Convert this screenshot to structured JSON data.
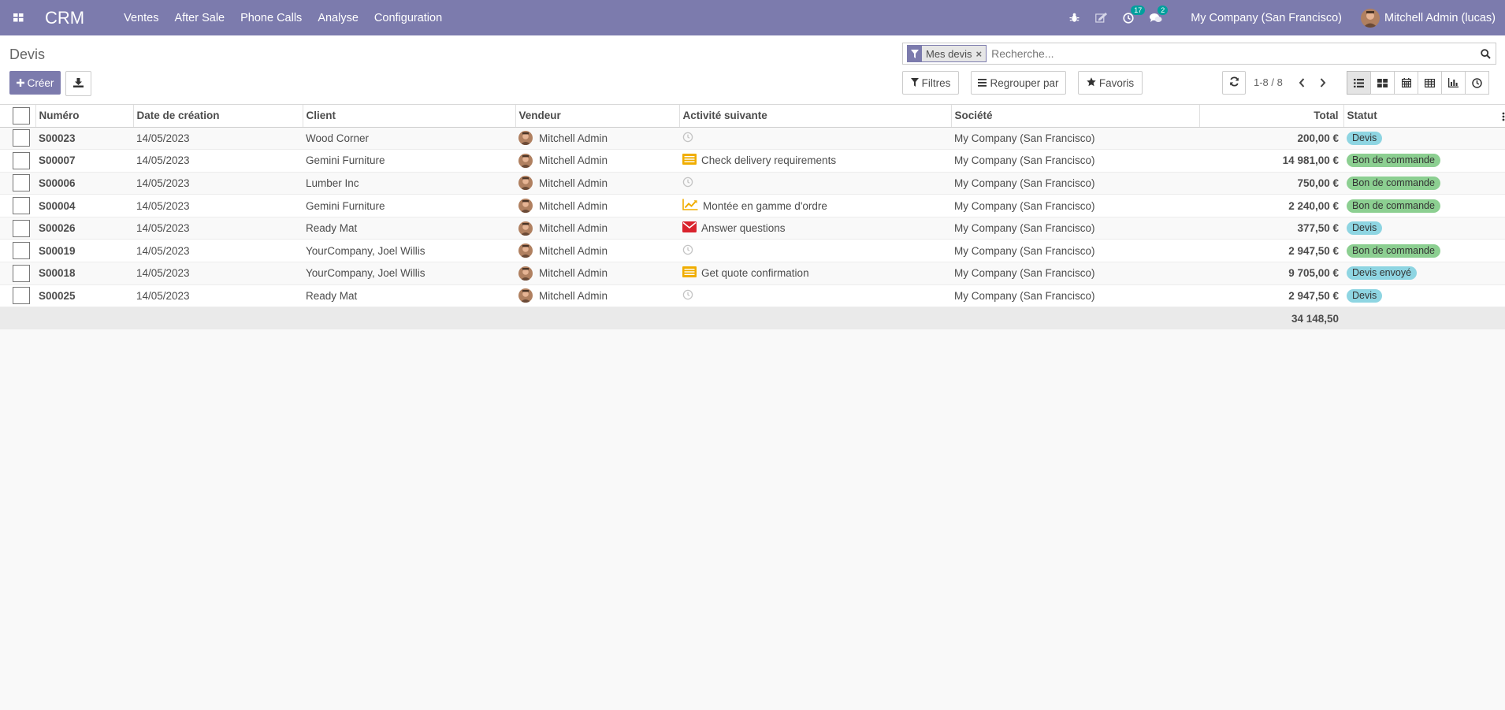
{
  "navbar": {
    "brand": "CRM",
    "menu": [
      "Ventes",
      "After Sale",
      "Phone Calls",
      "Analyse",
      "Configuration"
    ],
    "activities_count": "17",
    "messages_count": "2",
    "company": "My Company (San Francisco)",
    "user": "Mitchell Admin (lucas)"
  },
  "control_panel": {
    "title": "Devis",
    "create_label": "Créer",
    "facet_label": "Mes devis",
    "facet_close": "×",
    "search_placeholder": "Recherche...",
    "filters_label": "Filtres",
    "groupby_label": "Regrouper par",
    "favorites_label": "Favoris",
    "pager": "1-8 / 8"
  },
  "table": {
    "headers": [
      "Numéro",
      "Date de création",
      "Client",
      "Vendeur",
      "Activité suivante",
      "Société",
      "Total",
      "Statut"
    ],
    "rows": [
      {
        "number": "S00023",
        "date": "14/05/2023",
        "client": "Wood Corner",
        "vendor": "Mitchell Admin",
        "activity_icon": "clock-icon",
        "activity": "",
        "company": "My Company (San Francisco)",
        "total": "200,00 €",
        "status": "Devis",
        "status_type": "info"
      },
      {
        "number": "S00007",
        "date": "14/05/2023",
        "client": "Gemini Furniture",
        "vendor": "Mitchell Admin",
        "activity_icon": "todo-icon",
        "activity": "Check delivery requirements",
        "company": "My Company (San Francisco)",
        "total": "14 981,00 €",
        "status": "Bon de commande",
        "status_type": "success"
      },
      {
        "number": "S00006",
        "date": "14/05/2023",
        "client": "Lumber Inc",
        "vendor": "Mitchell Admin",
        "activity_icon": "clock-icon",
        "activity": "",
        "company": "My Company (San Francisco)",
        "total": "750,00 €",
        "status": "Bon de commande",
        "status_type": "success"
      },
      {
        "number": "S00004",
        "date": "14/05/2023",
        "client": "Gemini Furniture",
        "vendor": "Mitchell Admin",
        "activity_icon": "upsell-chart-icon",
        "activity": "Montée en gamme d'ordre",
        "company": "My Company (San Francisco)",
        "total": "2 240,00 €",
        "status": "Bon de commande",
        "status_type": "success"
      },
      {
        "number": "S00026",
        "date": "14/05/2023",
        "client": "Ready Mat",
        "vendor": "Mitchell Admin",
        "activity_icon": "envelope-icon",
        "activity": "Answer questions",
        "company": "My Company (San Francisco)",
        "total": "377,50 €",
        "status": "Devis",
        "status_type": "info"
      },
      {
        "number": "S00019",
        "date": "14/05/2023",
        "client": "YourCompany, Joel Willis",
        "vendor": "Mitchell Admin",
        "activity_icon": "clock-icon",
        "activity": "",
        "company": "My Company (San Francisco)",
        "total": "2 947,50 €",
        "status": "Bon de commande",
        "status_type": "success"
      },
      {
        "number": "S00018",
        "date": "14/05/2023",
        "client": "YourCompany, Joel Willis",
        "vendor": "Mitchell Admin",
        "activity_icon": "todo-icon",
        "activity": "Get quote confirmation",
        "company": "My Company (San Francisco)",
        "total": "9 705,00 €",
        "status": "Devis envoyé",
        "status_type": "info"
      },
      {
        "number": "S00025",
        "date": "14/05/2023",
        "client": "Ready Mat",
        "vendor": "Mitchell Admin",
        "activity_icon": "clock-icon",
        "activity": "",
        "company": "My Company (San Francisco)",
        "total": "2 947,50 €",
        "status": "Devis",
        "status_type": "info"
      }
    ],
    "footer_total": "34 148,50"
  },
  "colors": {
    "brand": "#7c7bad",
    "badge_info": "#8ed5e2",
    "badge_success": "#8ccf91",
    "todo_icon": "#f0ad00",
    "envelope_icon": "#d9232d"
  }
}
